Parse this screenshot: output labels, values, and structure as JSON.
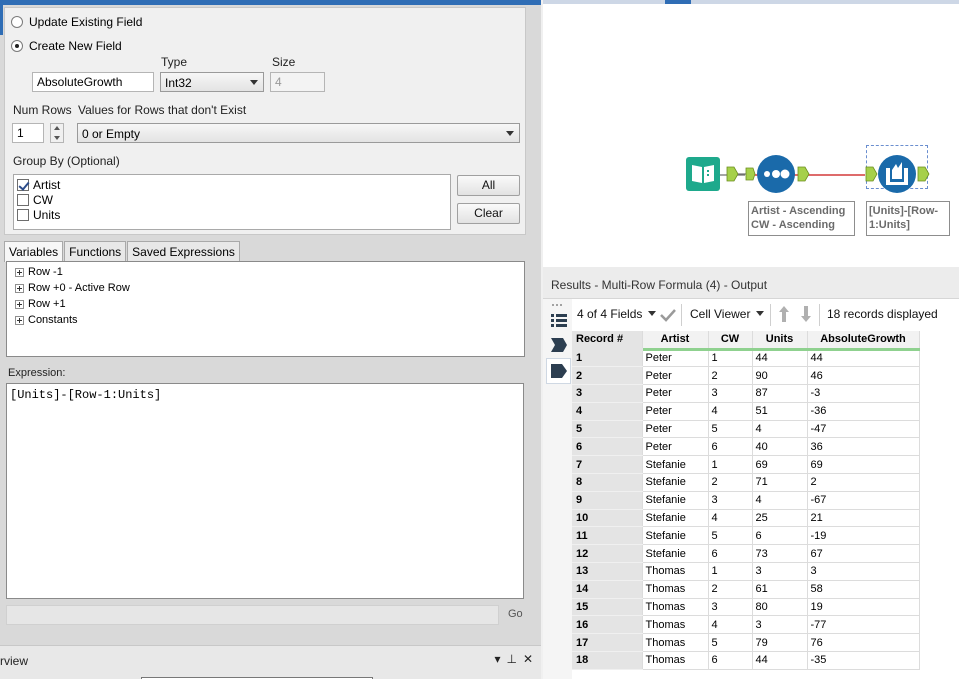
{
  "config": {
    "update_existing_label": "Update Existing Field",
    "create_new_label": "Create New  Field",
    "type_label": "Type",
    "size_label": "Size",
    "field_name_value": "AbsoluteGrowth",
    "type_value": "Int32",
    "size_value": "4",
    "num_rows_label": "Num Rows",
    "values_label": "Values for Rows that don't Exist",
    "num_rows_value": "1",
    "values_value": "0 or Empty",
    "group_by_label": "Group By (Optional)",
    "group_fields": [
      {
        "label": "Artist",
        "checked": true
      },
      {
        "label": "CW",
        "checked": false
      },
      {
        "label": "Units",
        "checked": false
      }
    ],
    "all_label": "All",
    "clear_label": "Clear"
  },
  "tabs": [
    "Variables",
    "Functions",
    "Saved Expressions"
  ],
  "variables": [
    "Row -1",
    "Row +0 - Active Row",
    "Row +1",
    "Constants"
  ],
  "expression_label": "Expression:",
  "expression_value": "[Units]-[Row-1:Units]",
  "go_label": "Go",
  "overview": {
    "title": "rview",
    "controls": [
      "▾",
      "⊥",
      "✕"
    ]
  },
  "canvas": {
    "sort_annotation": [
      "Artist - Ascending",
      "CW - Ascending"
    ],
    "formula_annotation": [
      "[Units]-[Row-",
      "1:Units]"
    ],
    "colors": {
      "input": "#1ea98c",
      "sort": "#1a6aaa",
      "formula": "#1a6aaa",
      "connector": "#d43a3a",
      "anchor": "#a6d04a"
    }
  },
  "results": {
    "title": "Results - Multi-Row Formula (4) - Output",
    "fields_label": "4 of 4 Fields",
    "viewer_label": "Cell Viewer",
    "records_label": "18 records displayed",
    "columns": [
      "Record #",
      "Artist",
      "CW",
      "Units",
      "AbsoluteGrowth"
    ],
    "rows": [
      [
        "1",
        "Peter",
        "1",
        "44",
        "44"
      ],
      [
        "2",
        "Peter",
        "2",
        "90",
        "46"
      ],
      [
        "3",
        "Peter",
        "3",
        "87",
        "-3"
      ],
      [
        "4",
        "Peter",
        "4",
        "51",
        "-36"
      ],
      [
        "5",
        "Peter",
        "5",
        "4",
        "-47"
      ],
      [
        "6",
        "Peter",
        "6",
        "40",
        "36"
      ],
      [
        "7",
        "Stefanie",
        "1",
        "69",
        "69"
      ],
      [
        "8",
        "Stefanie",
        "2",
        "71",
        "2"
      ],
      [
        "9",
        "Stefanie",
        "3",
        "4",
        "-67"
      ],
      [
        "10",
        "Stefanie",
        "4",
        "25",
        "21"
      ],
      [
        "11",
        "Stefanie",
        "5",
        "6",
        "-19"
      ],
      [
        "12",
        "Stefanie",
        "6",
        "73",
        "67"
      ],
      [
        "13",
        "Thomas",
        "1",
        "3",
        "3"
      ],
      [
        "14",
        "Thomas",
        "2",
        "61",
        "58"
      ],
      [
        "15",
        "Thomas",
        "3",
        "80",
        "19"
      ],
      [
        "16",
        "Thomas",
        "4",
        "3",
        "-77"
      ],
      [
        "17",
        "Thomas",
        "5",
        "79",
        "76"
      ],
      [
        "18",
        "Thomas",
        "6",
        "44",
        "-35"
      ]
    ]
  }
}
